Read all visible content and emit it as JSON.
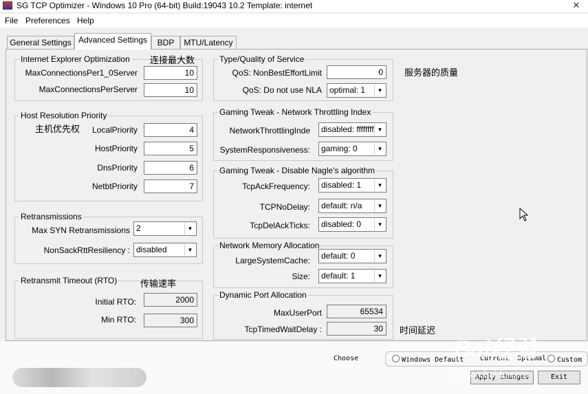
{
  "window": {
    "title": "SG TCP Optimizer - Windows 10 Pro (64-bit) Build:19043 10.2  Template: internet",
    "close_glyph": "✕"
  },
  "menu": [
    "File",
    "Preferences",
    "Help"
  ],
  "tabs": [
    "General Settings",
    "Advanced Settings",
    "BDP",
    "MTU/Latency"
  ],
  "ie": {
    "legend": "Internet Explorer Optimization",
    "fields": [
      {
        "label": "MaxConnectionsPer1_0Server",
        "value": "10"
      },
      {
        "label": "MaxConnectionsPerServer",
        "value": "10"
      }
    ]
  },
  "host": {
    "legend": "Host Resolution Priority",
    "fields": [
      {
        "label": "LocalPriority",
        "value": "4"
      },
      {
        "label": "HostPriority",
        "value": "5"
      },
      {
        "label": "DnsPriority",
        "value": "6"
      },
      {
        "label": "NetbtPriority",
        "value": "7"
      }
    ]
  },
  "retrans": {
    "legend": "Retransmissions",
    "fields": [
      {
        "label": "Max SYN Retransmissions",
        "value": "2"
      },
      {
        "label": "NonSackRttResiliency :",
        "value": "disabled"
      }
    ]
  },
  "rto": {
    "legend": "Retransmit Timeout (RTO)",
    "fields": [
      {
        "label": "Initial RTO:",
        "value": "2000"
      },
      {
        "label": "Min RTO:",
        "value": "300"
      }
    ]
  },
  "qos": {
    "legend": "Type/Quality of Service",
    "fields": [
      {
        "label": "QoS: NonBestEffortLimit",
        "value": "0"
      },
      {
        "label": "QoS: Do not use NLA",
        "value": "optimal: 1"
      }
    ]
  },
  "throttle": {
    "legend": "Gaming Tweak - Network Throttling Index",
    "fields": [
      {
        "label": "NetworkThrottlingInde",
        "value": "disabled: ffffffff"
      },
      {
        "label": "SystemResponsiveness:",
        "value": "gaming: 0"
      }
    ]
  },
  "nagle": {
    "legend": "Gaming Tweak - Disable Nagle's algorithm",
    "fields": [
      {
        "label": "TcpAckFrequency:",
        "value": "disabled: 1"
      },
      {
        "label": "TCPNoDelay:",
        "value": "default: n/a"
      },
      {
        "label": "TcpDelAckTicks:",
        "value": "disabled: 0"
      }
    ]
  },
  "memory": {
    "legend": "Network Memory Allocation",
    "fields": [
      {
        "label": "LargeSystemCache:",
        "value": "default: 0"
      },
      {
        "label": "Size:",
        "value": "default: 1"
      }
    ]
  },
  "dynport": {
    "legend": "Dynamic Port Allocation",
    "fields": [
      {
        "label": "MaxUserPort",
        "value": "65534"
      },
      {
        "label": "TcpTimedWaitDelay :",
        "value": "30"
      }
    ]
  },
  "notes": {
    "max_conn": "连接最大数",
    "host_priority": "主机优先权",
    "transfer_rate": "传输速率",
    "server_quality": "服务器的质量",
    "time_delay": "时间延迟"
  },
  "bottom": {
    "choose": "Choose",
    "radios": [
      "Windows Default",
      "Current",
      "Optimal",
      "Custom"
    ],
    "apply": "Apply changes",
    "exit": "Exit"
  },
  "watermark": {
    "logo": "Bai经验",
    "url": "jingyan.baidu.com"
  },
  "icons": {
    "dropdown": "▼"
  }
}
